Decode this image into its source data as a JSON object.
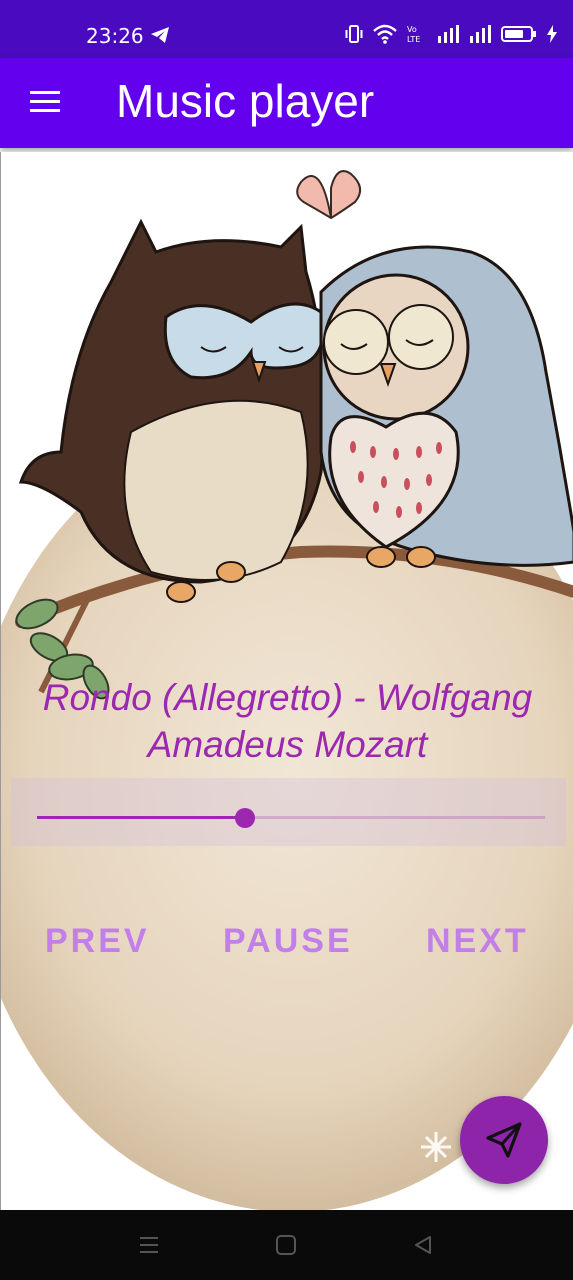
{
  "status_bar": {
    "time": "23:26",
    "icons": [
      "telegram-icon",
      "vibrate-icon",
      "wifi-icon",
      "volte-icon",
      "signal-icon",
      "signal-icon",
      "battery-icon",
      "charging-icon"
    ]
  },
  "app_bar": {
    "title": "Music player",
    "menu_icon": "hamburger-menu-icon"
  },
  "player": {
    "song_title": "Rondo (Allegretto) - Wolfgang Amadeus Mozart",
    "progress": 0.41,
    "artwork": "two-owls-on-branch-illustration"
  },
  "controls": {
    "prev_label": "PREV",
    "pause_label": "PAUSE",
    "next_label": "NEXT"
  },
  "fab": {
    "icon": "send-icon"
  },
  "nav_bar": {
    "icons": [
      "recents-icon",
      "home-icon",
      "back-icon"
    ]
  },
  "colors": {
    "status_bar": "#4a0bc0",
    "app_bar": "#6300ee",
    "accent": "#9c27b0",
    "button_text": "#c27fe8",
    "fab": "#8e24aa"
  }
}
